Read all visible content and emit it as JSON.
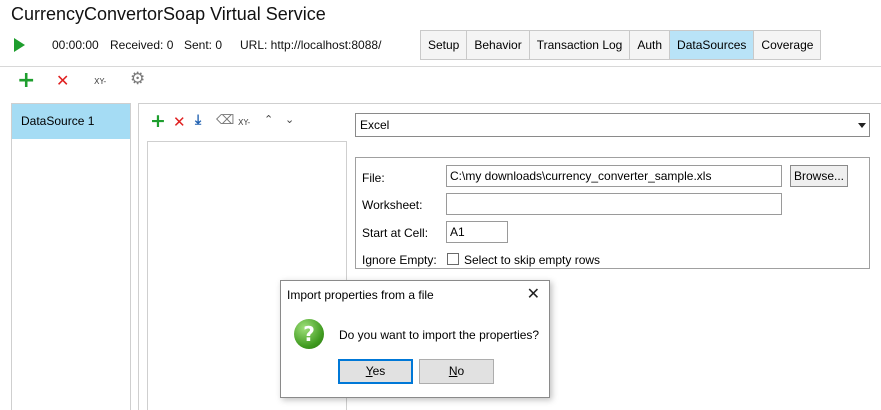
{
  "window": {
    "title": "CurrencyConvertorSoap Virtual Service"
  },
  "runbar": {
    "play_icon": "play-icon",
    "elapsed": "00:00:00",
    "received": "Received: 0",
    "sent": "Sent: 0",
    "url": "URL: http://localhost:8088/"
  },
  "tabs": [
    {
      "label": "Setup"
    },
    {
      "label": "Behavior"
    },
    {
      "label": "Transaction Log"
    },
    {
      "label": "Auth"
    },
    {
      "label": "DataSources",
      "active": true
    },
    {
      "label": "Coverage"
    }
  ],
  "toolbar": {
    "add_glyph": "+",
    "remove_glyph": "✕",
    "xy_glyph": "XY-"
  },
  "datasources": [
    {
      "label": "DataSource 1"
    }
  ],
  "properties_toolbar": {
    "add_glyph": "+",
    "remove_glyph": "✕",
    "xy_glyph": "XY-"
  },
  "source_type": {
    "selected": "Excel"
  },
  "excel": {
    "file_label": "File:",
    "file_value": "C:\\my downloads\\currency_converter_sample.xls",
    "browse_label": "Browse...",
    "worksheet_label": "Worksheet:",
    "worksheet_value": "",
    "start_cell_label": "Start at Cell:",
    "start_cell_value": "A1",
    "ignore_empty_label": "Ignore Empty:",
    "ignore_empty_text": "Select to skip empty rows",
    "ignore_empty_checked": false
  },
  "dialog": {
    "title": "Import properties from a file",
    "message": "Do you want to import the properties?",
    "yes_rest": "es",
    "yes_mnemonic": "Y",
    "no_rest": "o",
    "no_mnemonic": "N",
    "icon": "question-icon"
  },
  "colors": {
    "accent_tab": "#b9e3f7",
    "selected_item": "#a5dcf4",
    "add_green": "#1e9e2e",
    "remove_red": "#e02020"
  }
}
